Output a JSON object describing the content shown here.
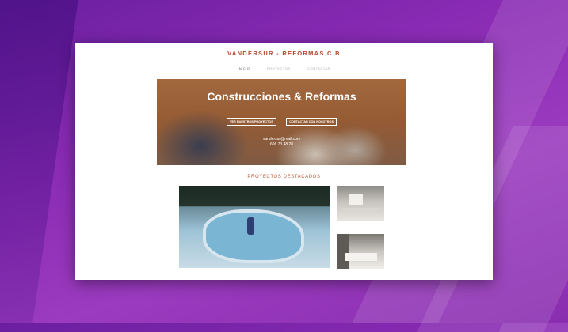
{
  "site": {
    "brand": "VANDERSUR - REFORMAS C.B",
    "nav": [
      {
        "label": "INICIO",
        "active": true
      },
      {
        "label": "PROYECTOS",
        "active": false
      },
      {
        "label": "CONTACTAR",
        "active": false
      }
    ]
  },
  "hero": {
    "title": "Construcciones & Reformas",
    "buttons": [
      "VER NUESTROS PROYECTOS",
      "CONTACTAR CON NOSOTROS"
    ],
    "email": "vandersur@mail.com",
    "phone": "606 73 48 28"
  },
  "featured": {
    "title": "PROYECTOS DESTACADOS"
  },
  "colors": {
    "brand": "#b8472d",
    "accent": "#c45a3c",
    "backdrop": "#8a2bb4"
  }
}
